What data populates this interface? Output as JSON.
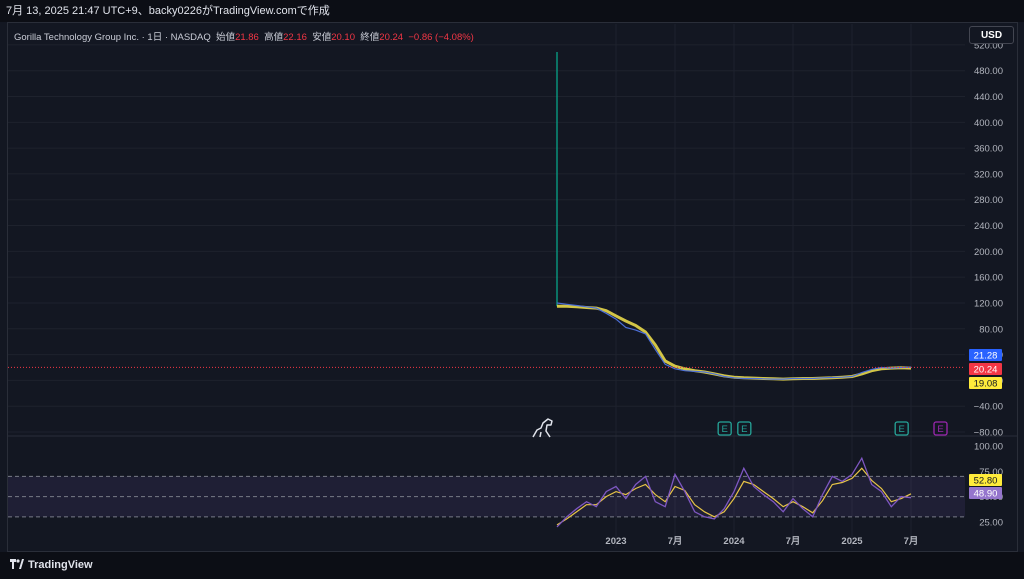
{
  "header": {
    "watermark": "7月 13, 2025 21:47 UTC+9、backy0226がTradingView.comで作成"
  },
  "legend": {
    "symbol": "Gorilla Technology Group Inc. · 1日 · NASDAQ",
    "open_label": "始値",
    "open": "21.86",
    "high_label": "高値",
    "high": "22.16",
    "low_label": "安値",
    "low": "20.10",
    "close_label": "終値",
    "close": "20.24",
    "change": "−0.86 (−4.08%)"
  },
  "currency": "USD",
  "brand": "TradingView",
  "colors": {
    "background": "#131722",
    "up": "#089981",
    "down": "#f23645",
    "ma_yellow": "#e8d84a",
    "rsi": "#7e57c2",
    "rsi_ma": "#e8c547",
    "blue_tag": "#2962ff",
    "earnings": "#26a69a",
    "earnings_future": "#9c27b0"
  },
  "chart_data": [
    {
      "type": "line",
      "title": "",
      "x_ticks": [
        "2023",
        "7月",
        "2024",
        "7月",
        "2025",
        "7月"
      ],
      "y_ticks": [
        "520.00",
        "480.00",
        "440.00",
        "400.00",
        "360.00",
        "320.00",
        "280.00",
        "240.00",
        "200.00",
        "160.00",
        "120.00",
        "80.00",
        "40.00",
        "0.00",
        "−40.00",
        "−80.00"
      ],
      "ylim": [
        -80,
        540
      ],
      "x": [
        "2022-07",
        "2022-08",
        "2022-09",
        "2022-10",
        "2022-11",
        "2022-12",
        "2023-01",
        "2023-02",
        "2023-03",
        "2023-04",
        "2023-05",
        "2023-06",
        "2023-07",
        "2023-08",
        "2023-09",
        "2023-10",
        "2023-11",
        "2023-12",
        "2024-01",
        "2024-02",
        "2024-03",
        "2024-04",
        "2024-05",
        "2024-06",
        "2024-07",
        "2024-08",
        "2024-09",
        "2024-10",
        "2024-11",
        "2024-12",
        "2025-01",
        "2025-02",
        "2025-03",
        "2025-04",
        "2025-05",
        "2025-06",
        "2025-07"
      ],
      "series": [
        {
          "values": [
            120,
            118,
            116,
            114,
            112,
            104,
            95,
            82,
            78,
            72,
            48,
            25,
            18,
            15,
            14,
            13,
            10,
            6,
            4,
            3,
            3,
            2.5,
            2,
            2,
            3,
            3,
            3,
            4,
            4.5,
            5,
            6,
            12,
            17,
            20,
            19,
            20,
            20.24
          ]
        },
        {
          "values": [
            115,
            115,
            114,
            113,
            112,
            108,
            100,
            92,
            85,
            75,
            55,
            30,
            22,
            18,
            15,
            13,
            10,
            7,
            5,
            4,
            3.5,
            3,
            2.5,
            2,
            2.5,
            3,
            3,
            3.5,
            4,
            5,
            6,
            10,
            15,
            18,
            19,
            19.5,
            19.08
          ]
        }
      ],
      "spike": {
        "date": "2022-07",
        "high": 509,
        "low": 115
      },
      "price_tags": [
        {
          "value": "21.28",
          "color": "#2962ff"
        },
        {
          "value": "20.24",
          "color": "#f23645"
        },
        {
          "value": "19.08",
          "color": "#ffeb3b"
        }
      ],
      "earnings_markers": [
        {
          "date": "2023-12",
          "label": "E"
        },
        {
          "date": "2024-02",
          "label": "E"
        },
        {
          "date": "2025-06",
          "label": "E"
        },
        {
          "date": "2025-10",
          "label": "E"
        }
      ]
    },
    {
      "type": "line",
      "title": "",
      "y_ticks": [
        "100.00",
        "75.00",
        "50.00",
        "25.00"
      ],
      "ylim": [
        15,
        105
      ],
      "bands": [
        70,
        50,
        30
      ],
      "x": [
        "2022-07",
        "2022-08",
        "2022-09",
        "2022-10",
        "2022-11",
        "2022-12",
        "2023-01",
        "2023-02",
        "2023-03",
        "2023-04",
        "2023-05",
        "2023-06",
        "2023-07",
        "2023-08",
        "2023-09",
        "2023-10",
        "2023-11",
        "2023-12",
        "2024-01",
        "2024-02",
        "2024-03",
        "2024-04",
        "2024-05",
        "2024-06",
        "2024-07",
        "2024-08",
        "2024-09",
        "2024-10",
        "2024-11",
        "2024-12",
        "2025-01",
        "2025-02",
        "2025-03",
        "2025-04",
        "2025-05",
        "2025-06",
        "2025-07"
      ],
      "series": [
        {
          "values": [
            20,
            30,
            38,
            45,
            40,
            55,
            60,
            48,
            62,
            70,
            45,
            40,
            72,
            55,
            35,
            30,
            28,
            38,
            55,
            78,
            60,
            52,
            45,
            35,
            48,
            38,
            30,
            52,
            70,
            65,
            72,
            88,
            62,
            55,
            40,
            50,
            48.9
          ]
        },
        {
          "values": [
            22,
            28,
            35,
            42,
            42,
            50,
            55,
            52,
            58,
            62,
            52,
            45,
            60,
            56,
            42,
            35,
            30,
            35,
            48,
            65,
            62,
            55,
            48,
            40,
            45,
            40,
            34,
            46,
            62,
            64,
            68,
            78,
            66,
            58,
            45,
            48,
            52.8
          ]
        }
      ],
      "price_tags": [
        {
          "value": "52.80",
          "color": "#ffeb3b"
        },
        {
          "value": "48.90",
          "color": "#9575cd"
        }
      ]
    }
  ]
}
